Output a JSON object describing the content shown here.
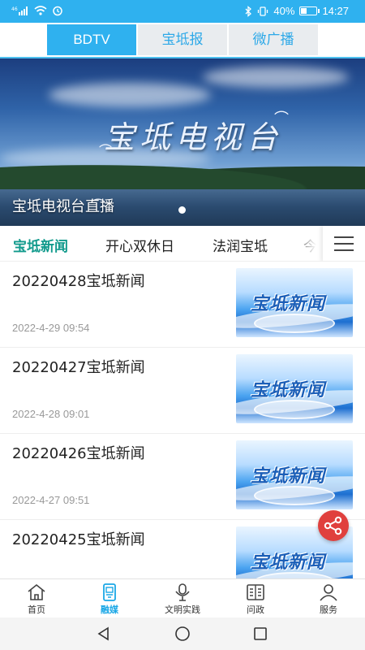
{
  "status_bar": {
    "signal_text": "⁴⁶",
    "battery_percent": "40%",
    "battery_level": 0.4,
    "time": "14:27"
  },
  "top_tabs": [
    {
      "label": "BDTV",
      "active": true
    },
    {
      "label": "宝坻报",
      "active": false
    },
    {
      "label": "微广播",
      "active": false
    }
  ],
  "banner": {
    "calligraphy": "宝坻电视台",
    "caption": "宝坻电视台直播"
  },
  "category_tabs": [
    {
      "label": "宝坻新闻",
      "active": true
    },
    {
      "label": "开心双休日",
      "active": false
    },
    {
      "label": "法润宝坻",
      "active": false
    },
    {
      "label": "今",
      "active": false
    }
  ],
  "news": [
    {
      "title": "20220428宝坻新闻",
      "time": "2022-4-29 09:54",
      "thumb_logo": "宝坻新闻"
    },
    {
      "title": "20220427宝坻新闻",
      "time": "2022-4-28 09:01",
      "thumb_logo": "宝坻新闻"
    },
    {
      "title": "20220426宝坻新闻",
      "time": "2022-4-27 09:51",
      "thumb_logo": "宝坻新闻"
    },
    {
      "title": "20220425宝坻新闻",
      "time": "",
      "thumb_logo": "宝坻新闻"
    }
  ],
  "bottom_nav": [
    {
      "label": "首页",
      "icon": "home-icon",
      "active": false
    },
    {
      "label": "融媒",
      "icon": "media-icon",
      "active": true
    },
    {
      "label": "文明实践",
      "icon": "microphone-icon",
      "active": false
    },
    {
      "label": "问政",
      "icon": "document-icon",
      "active": false
    },
    {
      "label": "服务",
      "icon": "person-icon",
      "active": false
    }
  ],
  "colors": {
    "accent": "#2fb1ef",
    "category_active": "#119a8c",
    "share": "#e0403d"
  }
}
